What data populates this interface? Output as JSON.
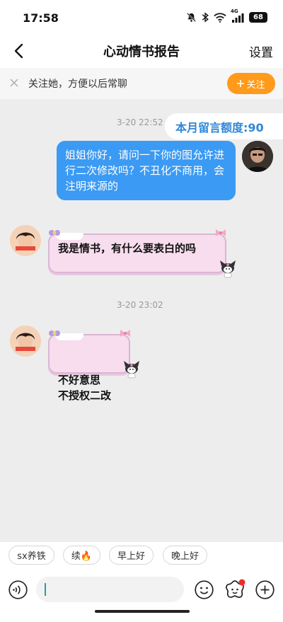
{
  "status_bar": {
    "time": "17:58",
    "battery": "68",
    "network": "4G"
  },
  "header": {
    "title": "心动情书报告",
    "settings_label": "设置"
  },
  "follow_banner": {
    "text": "关注她，方便以后常聊",
    "button_label": "关注",
    "button_color": "#ff9a1a"
  },
  "chat": {
    "quota": "本月留言额度:90",
    "messages": [
      {
        "time": "3-20 22:52",
        "sender": "self",
        "text": "姐姐你好，请问一下你的图允许进行二次修改吗？不丑化不商用，会注明来源的"
      },
      {
        "sender": "other",
        "text": "我是情书，有什么要表白的吗"
      },
      {
        "time": "3-20 23:02",
        "sender": "other",
        "text": "不好意思\n不授权二改"
      }
    ]
  },
  "quick_replies": [
    "sx养铁",
    "续🔥",
    "早上好",
    "晚上好"
  ],
  "colors": {
    "self_bubble": "#3b9af3",
    "other_bubble": "#f7dded",
    "accent_blue": "#2f87d8",
    "background": "#ededed"
  }
}
